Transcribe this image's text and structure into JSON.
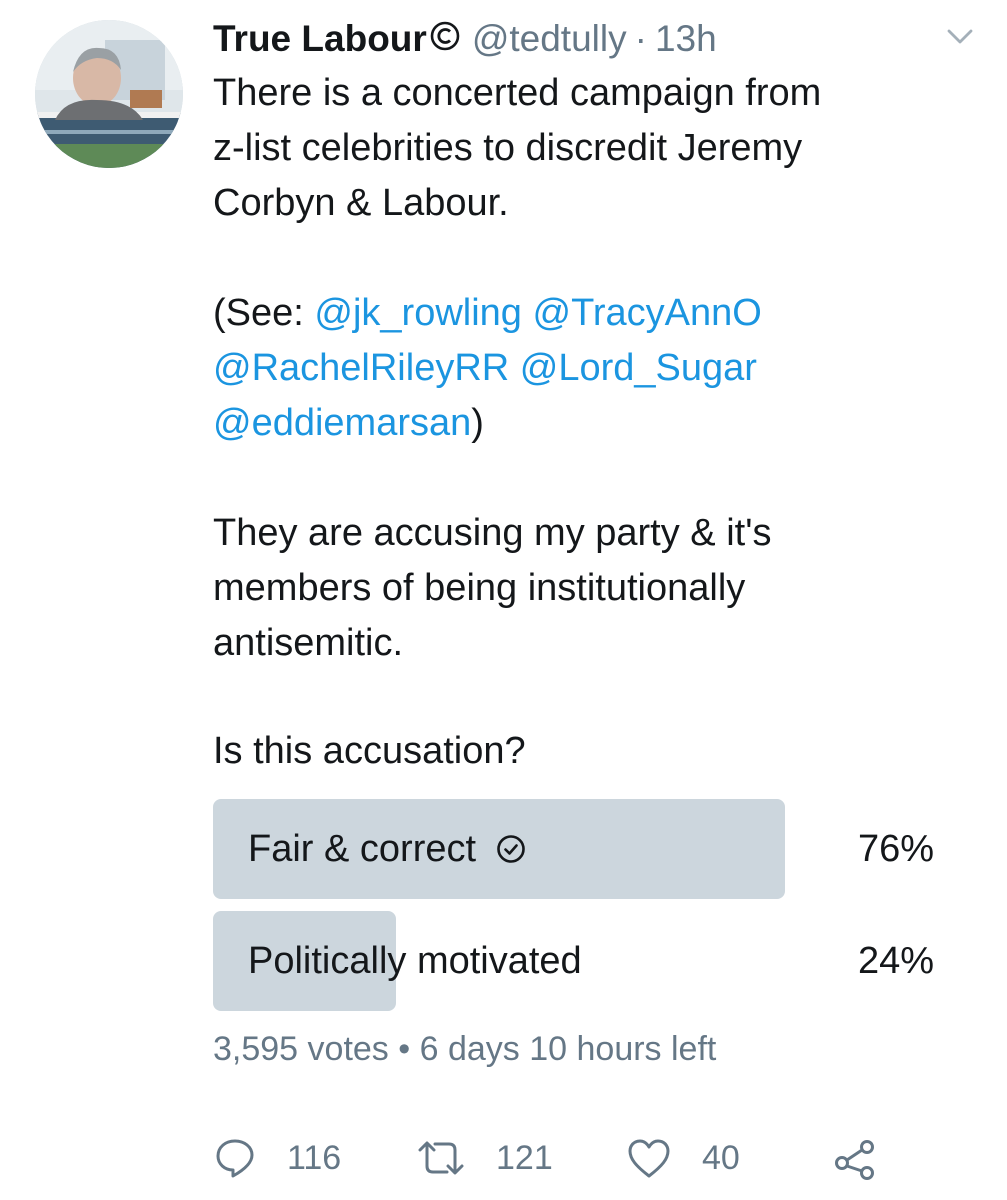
{
  "tweet": {
    "author_name": "True Labour",
    "handle": "@tedtully",
    "separator": "·",
    "time": "13h",
    "body": {
      "line1": "There is a concerted campaign from",
      "line2": "z-list celebrities to discredit Jeremy",
      "line3": "Corbyn & Labour.",
      "see_open": "(See: ",
      "mentions": [
        "@jk_rowling",
        "@TracyAnnO",
        "@RachelRileyRR",
        "@Lord_Sugar",
        "@eddiemarsan"
      ],
      "see_close": ")",
      "para3_line1": "They are accusing my party & it's",
      "para3_line2": "members of being institutionally",
      "para3_line3": "antisemitic."
    },
    "poll": {
      "question": "Is this accusation?",
      "options": [
        {
          "label": "Fair & correct",
          "percent_label": "76%",
          "share": 0.78,
          "selected": true
        },
        {
          "label": "Politically motivated",
          "percent_label": "24%",
          "share": 0.25,
          "selected": false
        }
      ],
      "votes": "3,595 votes",
      "bullet": "•",
      "time_left": "6 days 10 hours left"
    },
    "actions": {
      "reply_icon": "reply-icon",
      "replies": "116",
      "retweet_icon": "retweet-icon",
      "retweets": "121",
      "like_icon": "heart-icon",
      "likes": "40",
      "share_icon": "share-icon"
    },
    "colors": {
      "link": "#1b95e0",
      "secondary": "#657786",
      "poll_fill": "#ccd6dd",
      "text": "#14171a"
    }
  }
}
